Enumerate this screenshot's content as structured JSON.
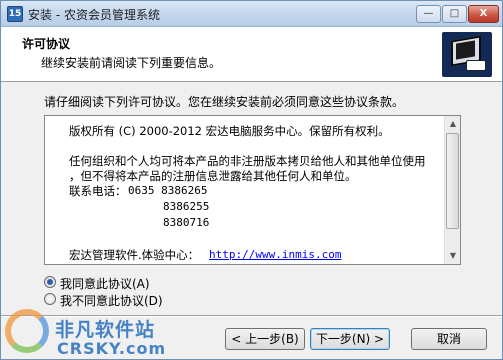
{
  "window": {
    "title": "安装 - 农资会员管理系统",
    "minimize_glyph": "—",
    "maximize_glyph": "□",
    "close_glyph": "X"
  },
  "header": {
    "title": "许可协议",
    "subtitle": "继续安装前请阅读下列重要信息。",
    "logo_icon": "computer-install-icon"
  },
  "intro_text": "请仔细阅读下列许可协议。您在继续安装前必须同意这些协议条款。",
  "license": {
    "copyright": "版权所有 (C) 2000-2012 宏达电脑服务中心。保留所有权利。",
    "terms_line1": "任何组织和个人均可将本产品的非注册版本拷贝给他人和其他单位使用",
    "terms_line2": "，但不得将本产品的注册信息泄露给其他任何人和单位。",
    "phone_label": "联系电话：",
    "phones": [
      "0635 8386265",
      "8386255",
      "8380716"
    ],
    "trial_label": "宏达管理软件.体验中心：",
    "trial_url": "http://www.inmis.com"
  },
  "options": {
    "accept": "我同意此协议(A)",
    "decline": "我不同意此协议(D)",
    "selected": "accept"
  },
  "buttons": {
    "back": "< 上一步(B)",
    "next": "下一步(N) >",
    "cancel": "取消"
  },
  "watermark": {
    "cn": "非凡软件站",
    "en": "CRSKY.com"
  },
  "colors": {
    "link": "#0000ee",
    "close_button": "#c9503f",
    "logo_background": "#132a57"
  }
}
